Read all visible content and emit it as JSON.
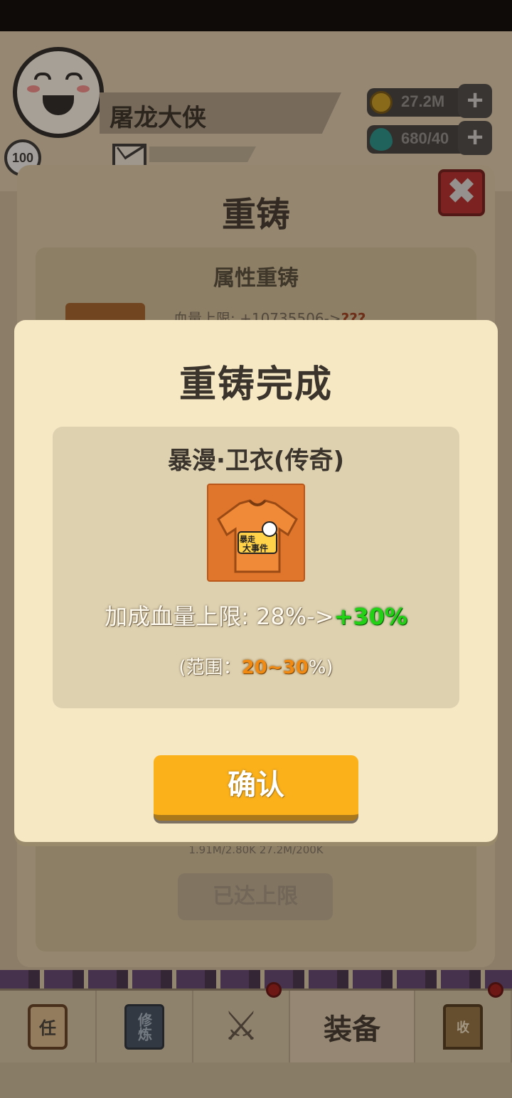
{
  "player": {
    "name": "屠龙大侠",
    "level": "100"
  },
  "resources": {
    "gold": "27.2M",
    "gems": "680/40"
  },
  "reforge_panel": {
    "title": "重铸",
    "section_title": "属性重铸",
    "stat_preview": "血量上限: +10735506->",
    "stat_preview_unknown": "???",
    "cost_text": "1.91M/2.80K  27.2M/200K",
    "limit_button": "已达上限"
  },
  "modal": {
    "title": "重铸完成",
    "item_name": "暴漫·卫衣(传奇)",
    "item_logo_line1": "暴走",
    "item_logo_line2": "大事件",
    "stat_label": "加成血量上限: ",
    "stat_old": "28%->",
    "stat_new": "+30%",
    "range_prefix": "(范围：",
    "range_value": "20~30",
    "range_suffix": "%)",
    "confirm_label": "确认"
  },
  "bottom_nav": {
    "task": "任",
    "train": "修炼",
    "equip": "装备",
    "collect": "收"
  },
  "colors": {
    "modal_bg": "#f7e8c4",
    "card_bg": "#ddd1b0",
    "button": "#fbb11a",
    "new_value": "#22d315",
    "range_highlight": "#f08a12"
  }
}
